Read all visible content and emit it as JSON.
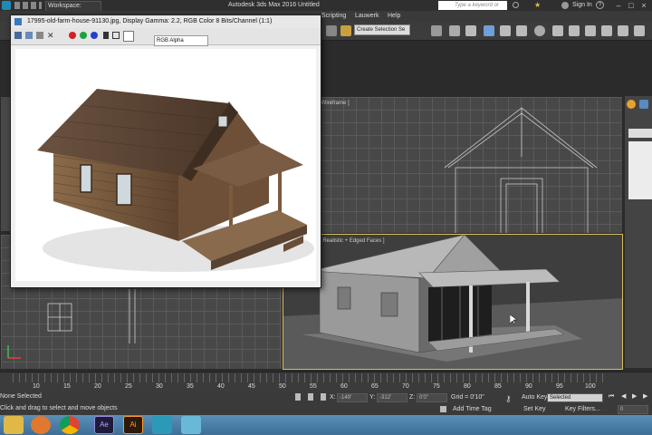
{
  "window": {
    "workspace": "Workspace: Default",
    "title": "Autodesk 3ds Max 2016    Untitled",
    "search_placeholder": "Type a keyword or phrase",
    "signin": "Sign In"
  },
  "menubar": {
    "items": [
      "Scripting",
      "Lauwerk",
      "Help"
    ]
  },
  "toolbar": {
    "selection_filter": "Create Selection Se"
  },
  "image_window": {
    "title": "17995-old-farm-house-91130.jpg, Display Gamma: 2.2, RGB Color 8 Bits/Channel (1:1)",
    "channel_select": "RGB Alpha",
    "swatch_colors": [
      "#d42020",
      "#20a040",
      "#2040d0"
    ]
  },
  "viewports": {
    "top_right_label": "[Wireframe ]",
    "perspective_label": "[ Realistic + Edged Faces ]"
  },
  "timeline": {
    "ticks": [
      "10",
      "15",
      "20",
      "25",
      "30",
      "35",
      "40",
      "45",
      "50",
      "55",
      "60",
      "65",
      "70",
      "75",
      "80",
      "85",
      "90",
      "95",
      "100"
    ]
  },
  "status": {
    "selected": "None Selected",
    "prompt": "Click and drag to select and move objects",
    "x_label": "X:",
    "x_value": "-149'",
    "y_label": "Y:",
    "y_value": "-312'",
    "z_label": "Z:",
    "z_value": "0'0\"",
    "grid": "Grid = 0'10\"",
    "add_time_tag": "Add Time Tag",
    "auto_key": "Auto Key",
    "key_mode": "Selected",
    "set_key": "Set Key",
    "key_filters": "Key Filters...",
    "frame": "0"
  },
  "taskbar": {
    "apps": [
      "windows-explorer",
      "media-player",
      "chrome",
      "after-effects",
      "illustrator",
      "3ds-max",
      "3ds-max-secondary"
    ]
  }
}
